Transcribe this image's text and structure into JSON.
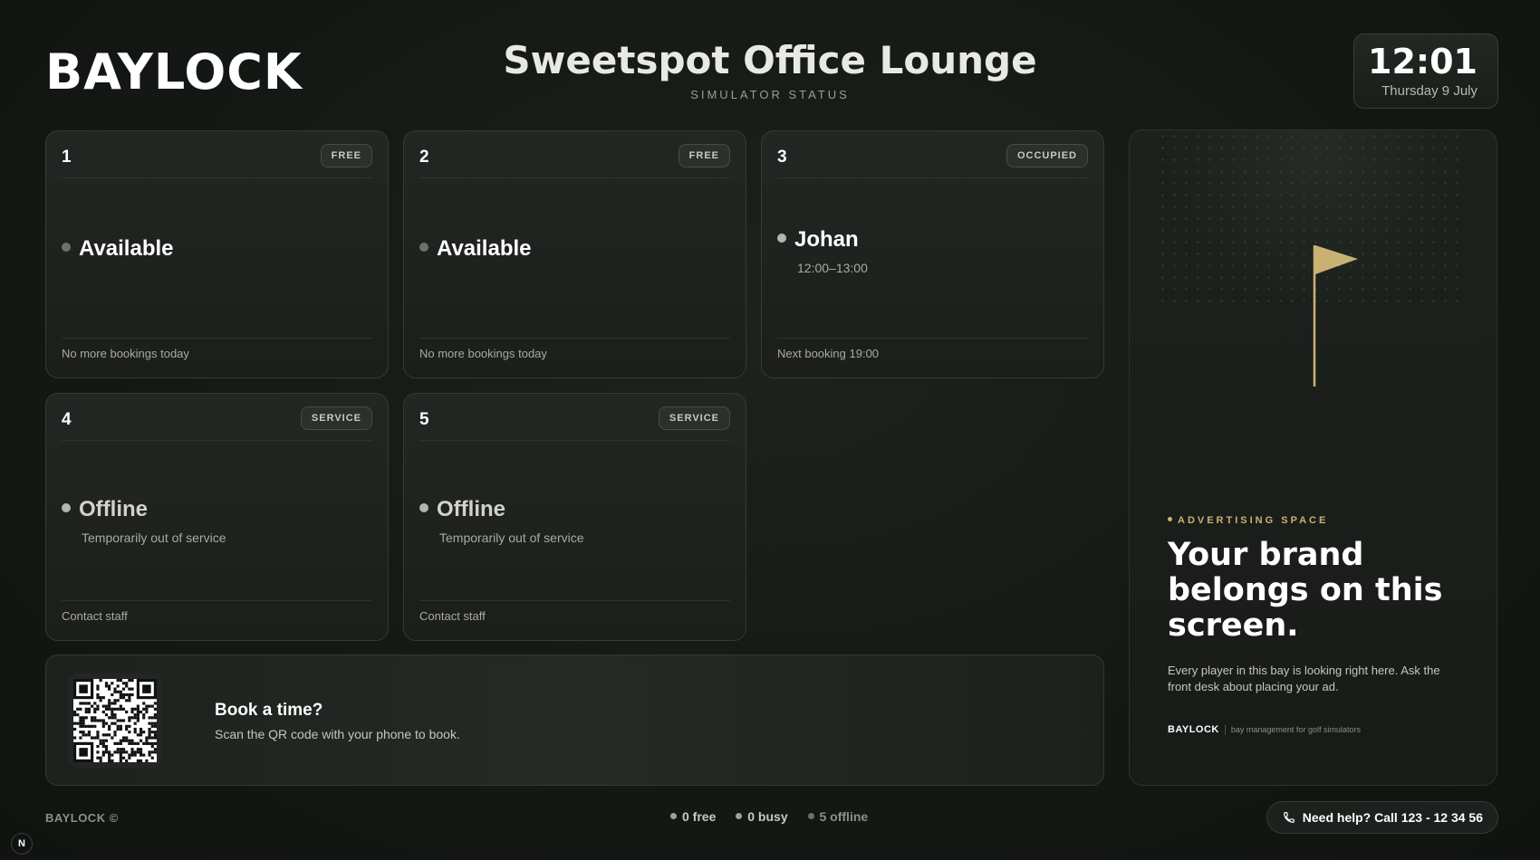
{
  "brand": "BAYLOCK",
  "header": {
    "title": "Sweetspot Office Lounge",
    "subtitle": "SIMULATOR STATUS"
  },
  "clock": {
    "time": "12:01",
    "date": "Thursday 9 July"
  },
  "bays": [
    {
      "number": "1",
      "badge": "FREE",
      "status": "Available",
      "detail": "",
      "footer": "No more bookings today"
    },
    {
      "number": "2",
      "badge": "FREE",
      "status": "Available",
      "detail": "",
      "footer": "No more bookings today"
    },
    {
      "number": "3",
      "badge": "OCCUPIED",
      "status": "Johan",
      "detail": "12:00–13:00",
      "footer": "Next booking 19:00"
    },
    {
      "number": "4",
      "badge": "SERVICE",
      "status": "Offline",
      "detail": "Temporarily out of service",
      "footer": "Contact staff"
    },
    {
      "number": "5",
      "badge": "SERVICE",
      "status": "Offline",
      "detail": "Temporarily out of service",
      "footer": "Contact staff"
    }
  ],
  "booking": {
    "title": "Book a time?",
    "text": "Scan the QR code with your phone to book."
  },
  "ad": {
    "tag": "ADVERTISING SPACE",
    "headline": "Your brand belongs on this screen.",
    "body": "Every player in this bay is looking right here. Ask the front desk about placing your ad.",
    "brand": "BAYLOCK",
    "tagline": "bay management for golf simulators",
    "accent_color": "#c9b174"
  },
  "footer": {
    "brand": "BAYLOCK ©",
    "stats": {
      "free": "0 free",
      "busy": "0 busy",
      "offline": "5 offline"
    },
    "help": "Need help? Call 123 - 12 34 56",
    "badge": "N"
  },
  "icons": {
    "help": "phone-icon",
    "ad": "golf-flag-icon",
    "booking": "qr-code-icon"
  }
}
